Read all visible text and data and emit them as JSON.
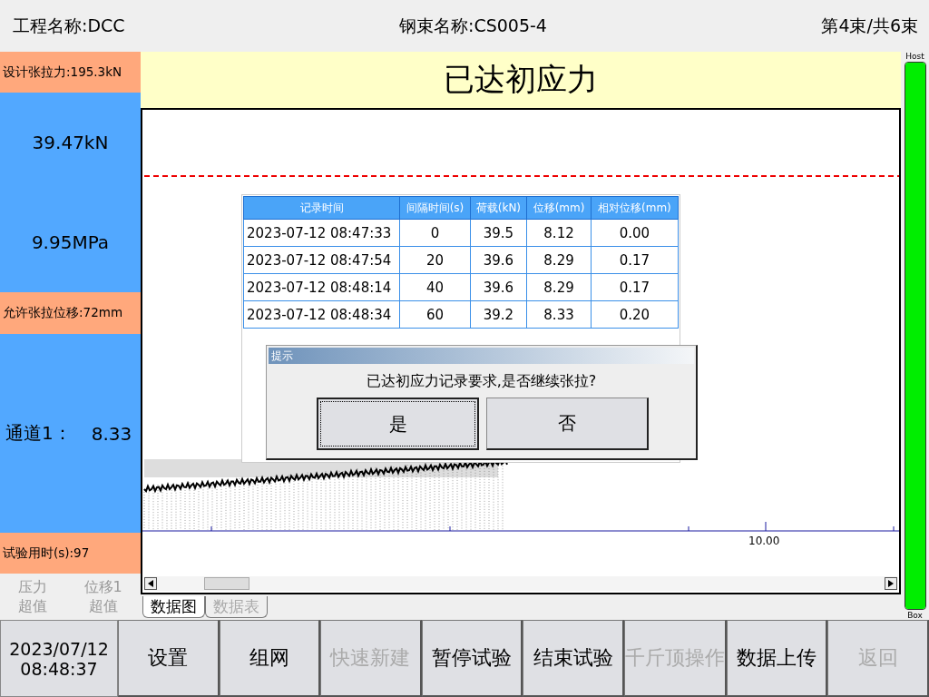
{
  "header": {
    "project": "工程名称:DCC",
    "strand": "钢束名称:CS005-4",
    "count": "第4束/共6束"
  },
  "left_panel": {
    "design_force": "设计张拉力:195.3kN",
    "force": "39.47kN",
    "pressure": "9.95MPa",
    "allowed_displacement": "允许张拉位移:72mm",
    "channel_label": "通道1：",
    "channel_value": "8.33",
    "elapsed": "试验用时(s):97",
    "alarms": [
      {
        "lines": [
          "压力",
          "超值"
        ],
        "active": false
      },
      {
        "lines": [
          "位移1",
          "超值"
        ],
        "active": false
      }
    ]
  },
  "status_title": "已达初应力",
  "chart": {
    "tick_label": "10.00"
  },
  "record_table": {
    "columns": [
      "记录时间",
      "间隔时间(s)",
      "荷载(kN)",
      "位移(mm)",
      "相对位移(mm)"
    ],
    "rows": [
      [
        "2023-07-12 08:47:33",
        "0",
        "39.5",
        "8.12",
        "0.00"
      ],
      [
        "2023-07-12 08:47:54",
        "20",
        "39.6",
        "8.29",
        "0.17"
      ],
      [
        "2023-07-12 08:48:14",
        "40",
        "39.6",
        "8.29",
        "0.17"
      ],
      [
        "2023-07-12 08:48:34",
        "60",
        "39.2",
        "8.33",
        "0.20"
      ]
    ]
  },
  "dialog": {
    "title": "提示",
    "message": "已达初应力记录要求,是否继续张拉?",
    "buttons": [
      {
        "label": "是",
        "focused": true
      },
      {
        "label": "否",
        "focused": false
      }
    ]
  },
  "tabs": [
    {
      "label": "数据图",
      "selected": true
    },
    {
      "label": "数据表",
      "selected": false
    }
  ],
  "connection": {
    "top_label": "Host",
    "bottom_label": "Box",
    "level": 1
  },
  "datetime": {
    "date": "2023/07/12",
    "time": "08:48:37"
  },
  "toolbar": [
    {
      "label": "设置",
      "disabled": false
    },
    {
      "label": "组网",
      "disabled": false
    },
    {
      "label": "快速新建",
      "disabled": true
    },
    {
      "label": "暂停试验",
      "disabled": false
    },
    {
      "label": "结束试验",
      "disabled": false
    },
    {
      "label": "千斤顶操作",
      "disabled": true
    },
    {
      "label": "数据上传",
      "disabled": false
    },
    {
      "label": "返回",
      "disabled": true
    }
  ]
}
